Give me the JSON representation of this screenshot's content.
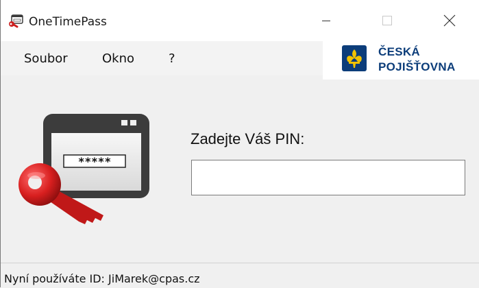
{
  "window": {
    "title": "OneTimePass",
    "controls": {
      "minimize": "minimize-icon",
      "maximize": "maximize-icon",
      "close": "close-icon"
    }
  },
  "menu": {
    "items": [
      "Soubor",
      "Okno",
      "?"
    ]
  },
  "logo": {
    "line1": "ČESKÁ",
    "line2": "POJIŠŤOVNA",
    "color": "#0c3d7a",
    "emblem_color": "#f2c200"
  },
  "illustration": {
    "masked_pin": "*****",
    "key_color": "#cc1e1e"
  },
  "form": {
    "pin_label": "Zadejte Váš PIN:",
    "pin_value": ""
  },
  "status": {
    "text": "Nyní používáte ID: JiMarek@cpas.cz"
  }
}
